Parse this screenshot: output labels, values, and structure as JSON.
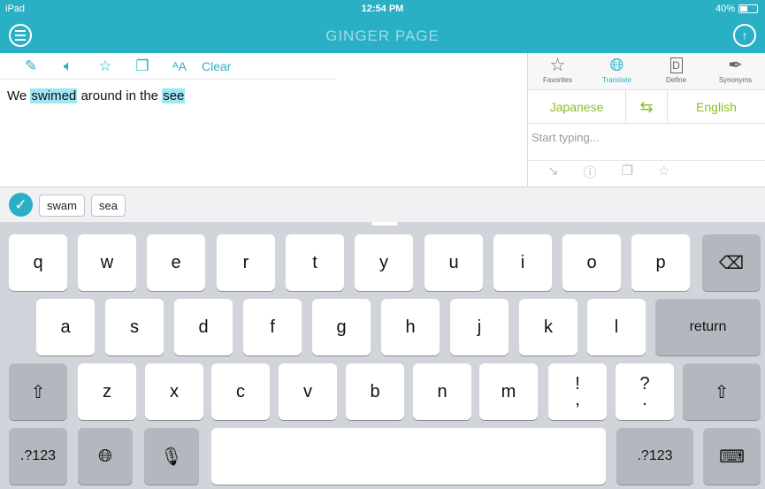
{
  "status": {
    "device": "iPad",
    "time": "12:54 PM",
    "battery": "40%"
  },
  "app": {
    "logo": "GINGER PAGE"
  },
  "editor": {
    "toolbar": {
      "clear_label": "Clear"
    },
    "text": {
      "w1": "We",
      "w2": "swimed",
      "w3": "around in the",
      "w4": "see"
    }
  },
  "panel": {
    "tabs": [
      {
        "label": "Favorites"
      },
      {
        "label": "Translate"
      },
      {
        "label": "Define"
      },
      {
        "label": "Synonyms"
      }
    ],
    "source_lang": "Japanese",
    "target_lang": "English",
    "placeholder": "Start typing..."
  },
  "suggestions": {
    "s1": "swam",
    "s2": "sea"
  },
  "keyboard": {
    "row1": [
      "q",
      "w",
      "e",
      "r",
      "t",
      "y",
      "u",
      "i",
      "o",
      "p"
    ],
    "row2": [
      "a",
      "s",
      "d",
      "f",
      "g",
      "h",
      "j",
      "k",
      "l"
    ],
    "row3": [
      "z",
      "x",
      "c",
      "v",
      "b",
      "n",
      "m"
    ],
    "punct1": {
      "top": "!",
      "bottom": ","
    },
    "punct2": {
      "top": "?",
      "bottom": "."
    },
    "return_label": "return",
    "numbers_label": ".?123"
  },
  "colors": {
    "brand": "#2ab0c5",
    "lang": "#8cbf1f",
    "highlight": "#9ee6f4"
  }
}
